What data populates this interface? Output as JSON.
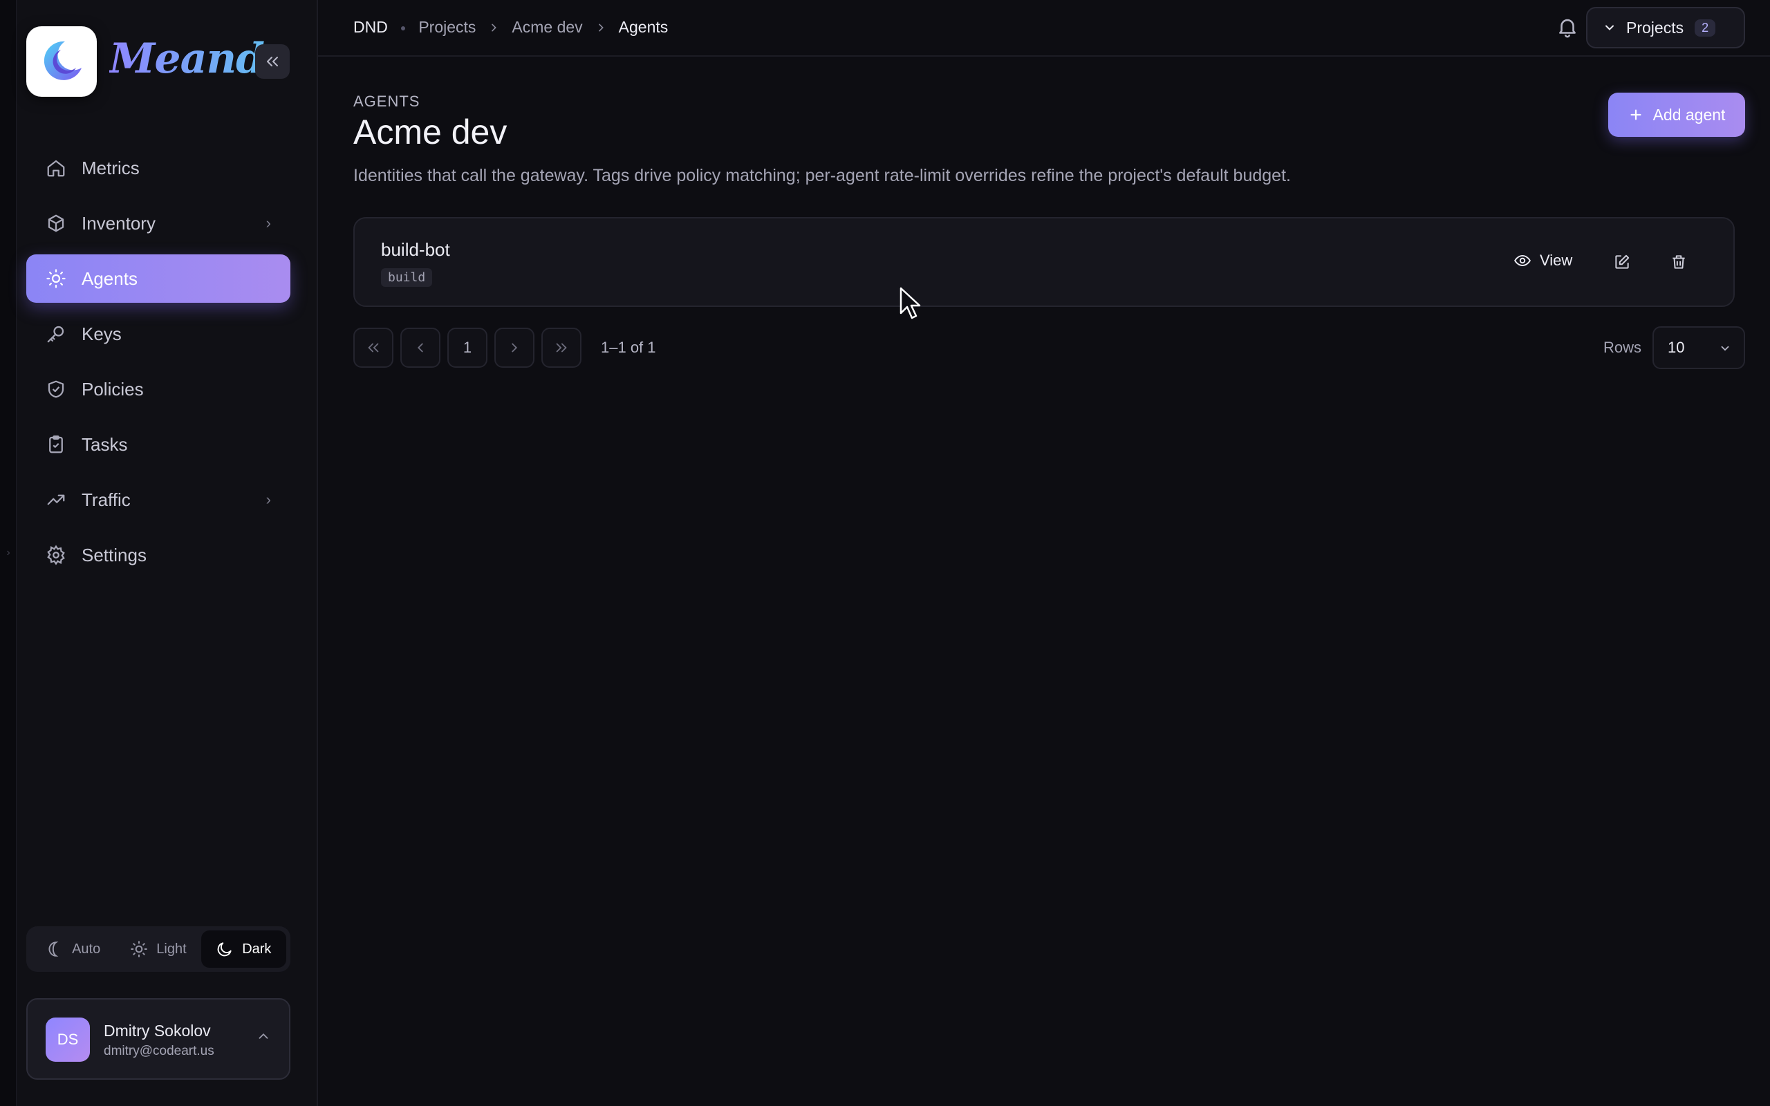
{
  "app": {
    "name": "Meandr"
  },
  "sidebar": {
    "items": [
      {
        "label": "Metrics",
        "icon": "home-icon"
      },
      {
        "label": "Inventory",
        "icon": "box-icon",
        "expandable": true
      },
      {
        "label": "Agents",
        "icon": "bulb-icon",
        "active": true
      },
      {
        "label": "Keys",
        "icon": "key-icon"
      },
      {
        "label": "Policies",
        "icon": "shield-check-icon"
      },
      {
        "label": "Tasks",
        "icon": "clipboard-check-icon"
      },
      {
        "label": "Traffic",
        "icon": "trending-up-icon",
        "expandable": true
      },
      {
        "label": "Settings",
        "icon": "gear-icon"
      }
    ],
    "theme": {
      "auto": "Auto",
      "light": "Light",
      "dark": "Dark",
      "selected": "Dark"
    },
    "user": {
      "initials": "DS",
      "name": "Dmitry Sokolov",
      "email": "dmitry@codeart.us"
    }
  },
  "breadcrumb": {
    "root": "DND",
    "projects": "Projects",
    "project": "Acme dev",
    "current": "Agents"
  },
  "header": {
    "projects_label": "Projects",
    "projects_count": "2"
  },
  "page": {
    "eyebrow": "AGENTS",
    "title": "Acme dev",
    "subtitle": "Identities that call the gateway. Tags drive policy matching; per-agent rate-limit overrides refine the project's default budget.",
    "add_label": "Add agent"
  },
  "agents": [
    {
      "name": "build-bot",
      "tag": "build",
      "view_label": "View"
    }
  ],
  "pagination": {
    "page": "1",
    "info": "1–1 of 1",
    "rows_label": "Rows",
    "rows_value": "10"
  },
  "colors": {
    "accent": "#8b85f5",
    "background": "#0d0d12",
    "sidebar": "#101015"
  }
}
